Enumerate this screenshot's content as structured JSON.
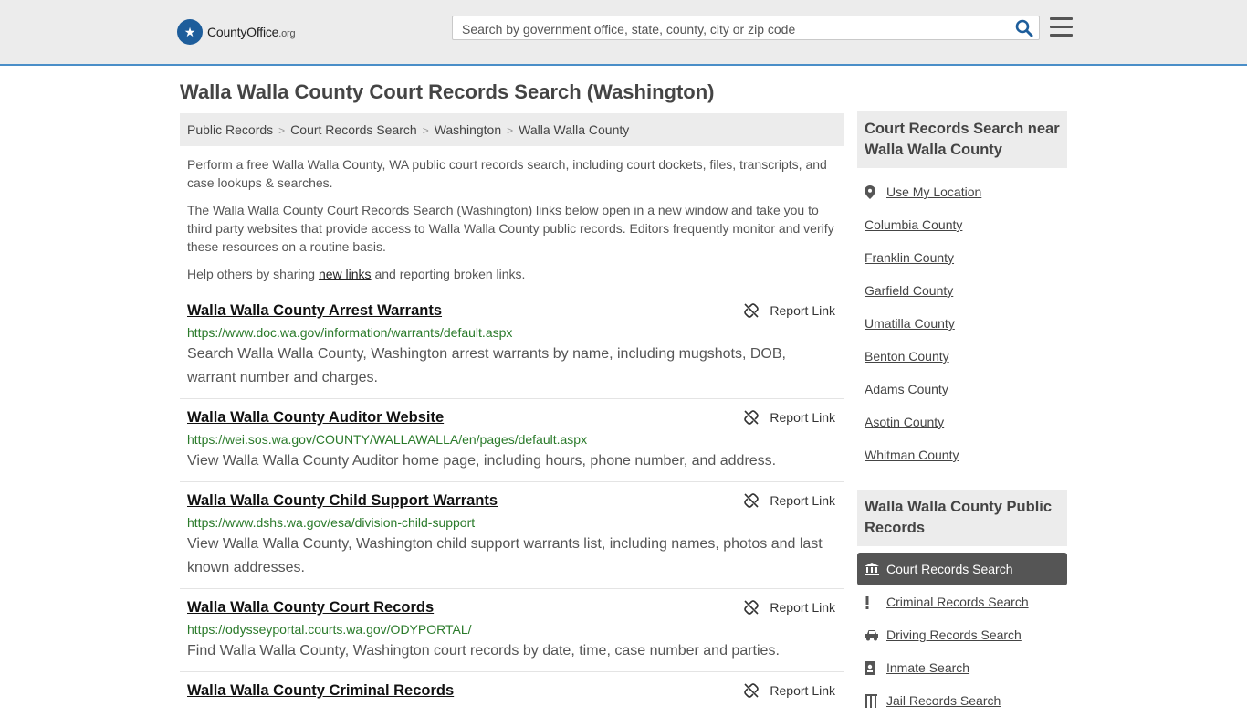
{
  "header": {
    "logo_main": "CountyOffice",
    "logo_suffix": ".org",
    "search_placeholder": "Search by government office, state, county, city or zip code"
  },
  "page_title": "Walla Walla County Court Records Search (Washington)",
  "breadcrumb": [
    "Public Records",
    "Court Records Search",
    "Washington",
    "Walla Walla County"
  ],
  "intro": {
    "p1": "Perform a free Walla Walla County, WA public court records search, including court dockets, files, transcripts, and case lookups & searches.",
    "p2": "The Walla Walla County Court Records Search (Washington) links below open in a new window and take you to third party websites that provide access to Walla Walla County public records. Editors frequently monitor and verify these resources on a routine basis.",
    "p3_before": "Help others by sharing ",
    "p3_link": "new links",
    "p3_after": " and reporting broken links."
  },
  "report_label": "Report Link",
  "records": [
    {
      "title": "Walla Walla County Arrest Warrants",
      "url": "https://www.doc.wa.gov/information/warrants/default.aspx",
      "desc": "Search Walla Walla County, Washington arrest warrants by name, including mugshots, DOB, warrant number and charges."
    },
    {
      "title": "Walla Walla County Auditor Website",
      "url": "https://wei.sos.wa.gov/COUNTY/WALLAWALLA/en/pages/default.aspx",
      "desc": "View Walla Walla County Auditor home page, including hours, phone number, and address."
    },
    {
      "title": "Walla Walla County Child Support Warrants",
      "url": "https://www.dshs.wa.gov/esa/division-child-support",
      "desc": "View Walla Walla County, Washington child support warrants list, including names, photos and last known addresses."
    },
    {
      "title": "Walla Walla County Court Records",
      "url": "https://odysseyportal.courts.wa.gov/ODYPORTAL/",
      "desc": "Find Walla Walla County, Washington court records by date, time, case number and parties."
    },
    {
      "title": "Walla Walla County Criminal Records",
      "url": "",
      "desc": ""
    }
  ],
  "sidebar": {
    "nearby_heading": "Court Records Search near Walla Walla County",
    "use_location": "Use My Location",
    "nearby": [
      "Columbia County",
      "Franklin County",
      "Garfield County",
      "Umatilla County",
      "Benton County",
      "Adams County",
      "Asotin County",
      "Whitman County"
    ],
    "public_heading": "Walla Walla County Public Records",
    "public_records": [
      {
        "label": "Court Records Search",
        "icon": "courthouse-icon"
      },
      {
        "label": "Criminal Records Search",
        "icon": "exclamation-icon"
      },
      {
        "label": "Driving Records Search",
        "icon": "car-icon"
      },
      {
        "label": "Inmate Search",
        "icon": "id-badge-icon"
      },
      {
        "label": "Jail Records Search",
        "icon": "jail-icon"
      }
    ]
  },
  "colors": {
    "accent": "#4a8ec8",
    "url_green": "#2a7a2a",
    "active_bg": "#555555"
  }
}
